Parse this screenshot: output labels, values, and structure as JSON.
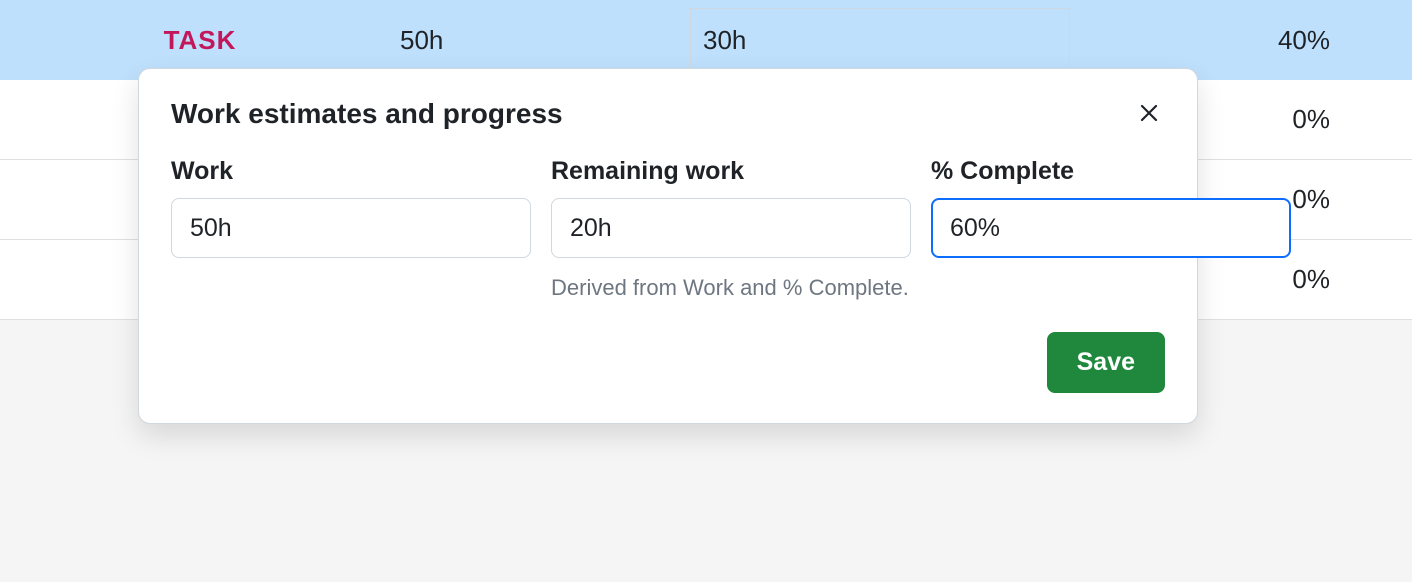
{
  "table": {
    "header": {
      "task_label": "TASK",
      "work": "50h",
      "remaining": "30h",
      "percent": "40%"
    },
    "rows": [
      {
        "percent": "0%"
      },
      {
        "percent": "0%"
      },
      {
        "percent": "0%"
      }
    ]
  },
  "popover": {
    "title": "Work estimates and progress",
    "fields": {
      "work": {
        "label": "Work",
        "value": "50h"
      },
      "remaining": {
        "label": "Remaining work",
        "value": "20h",
        "helper": "Derived from Work and % Complete."
      },
      "percent": {
        "label": "% Complete",
        "value": "60%"
      }
    },
    "save_label": "Save"
  }
}
